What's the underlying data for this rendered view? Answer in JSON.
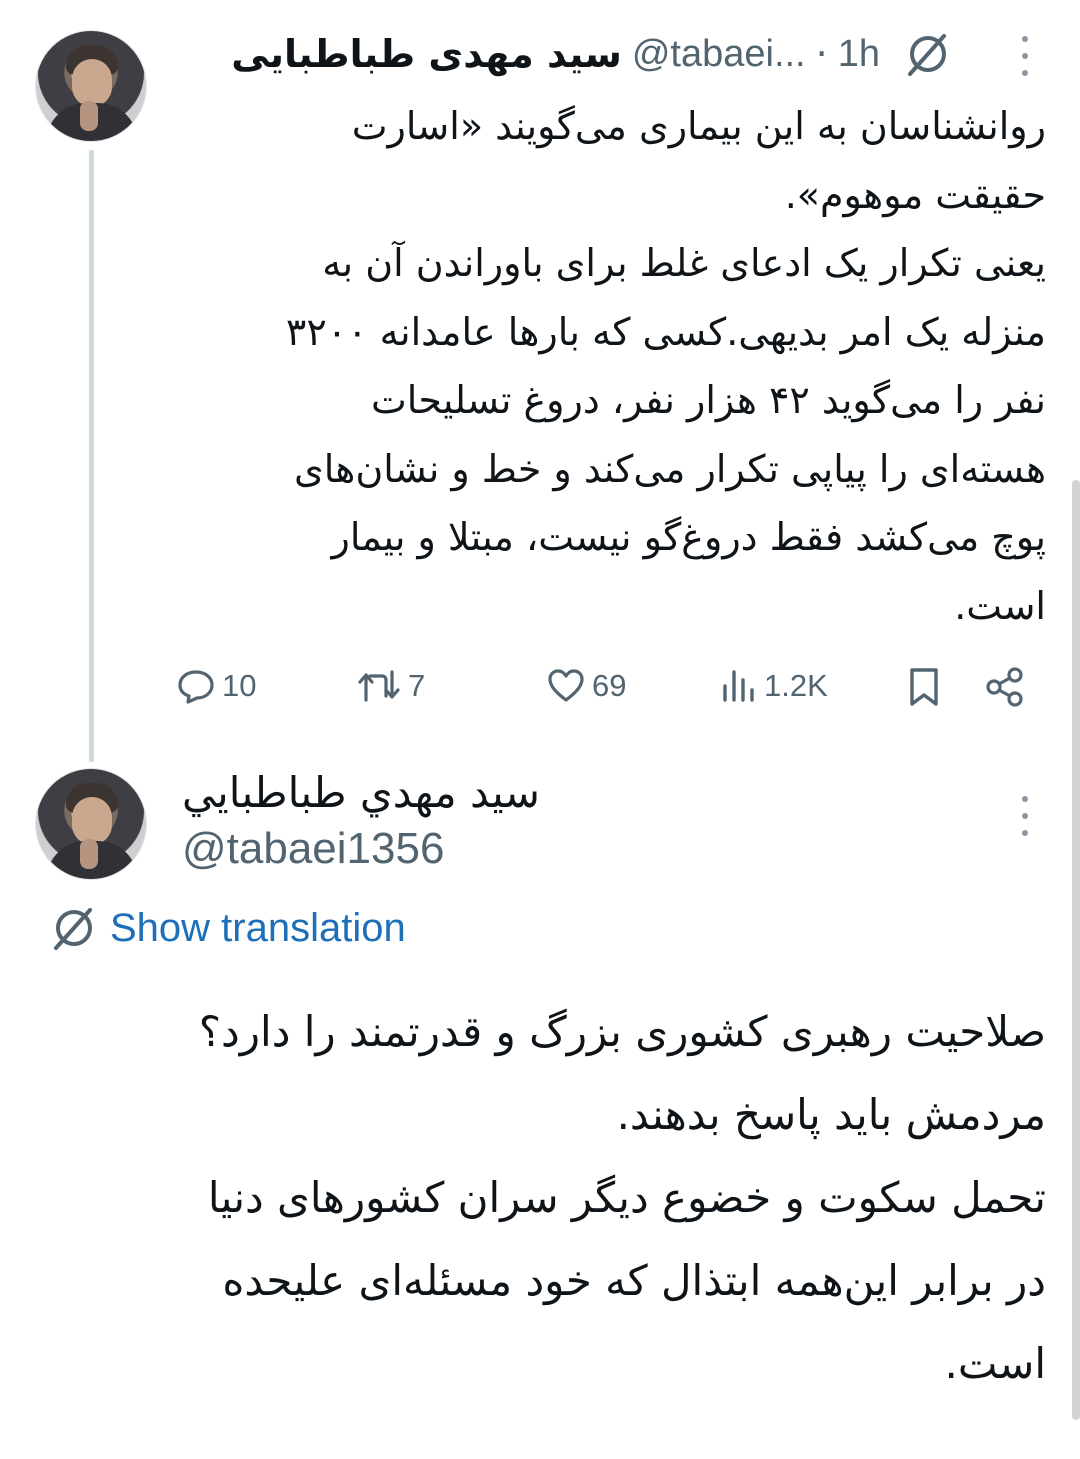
{
  "tweet1": {
    "display_name": "سید مهدی طباطبایی",
    "handle": "@tabaei...",
    "time_sep": "·",
    "time": "1h",
    "text": "روانشناسان به این بیماری می‌گویند «اسارت\nحقیقت موهوم».\nیعنی تکرار یک ادعای غلط برای باوراندن آن به\nمنزله یک امر بدیهی.کسی که بارها عامدانه  ۳۲۰۰\nنفر را می‌گوید ۴۲ هزار نفر، دروغ تسلیحات\nهسته‌ای را پیاپی تکرار می‌کند و خط و نشان‌های\nپوچ می‌کشد فقط دروغ‌گو نیست، مبتلا و بیمار\nاست.",
    "actions": {
      "replies": "10",
      "reposts": "7",
      "likes": "69",
      "views": "1.2K"
    }
  },
  "tweet2": {
    "display_name": "سيد مهدي طباطبايي",
    "handle": "@tabaei1356",
    "show_translation": "Show translation",
    "text": "صلاحیت رهبری کشوری بزرگ و قدرتمند را دارد؟\nمردمش باید پاسخ بدهند.\nتحمل سکوت و خضوع دیگر سران کشورهای دنیا\nدر برابر این‌همه ابتذال که خود مسئله‌ای علیحده\nاست."
  },
  "colors": {
    "text_primary": "#0f1419",
    "text_secondary": "#536471",
    "link": "#1d6fb8",
    "thread_line": "#cfd9de"
  },
  "icons": [
    "translate-icon",
    "more-icon",
    "reply-icon",
    "repost-icon",
    "like-icon",
    "views-icon",
    "bookmark-icon",
    "share-icon"
  ]
}
